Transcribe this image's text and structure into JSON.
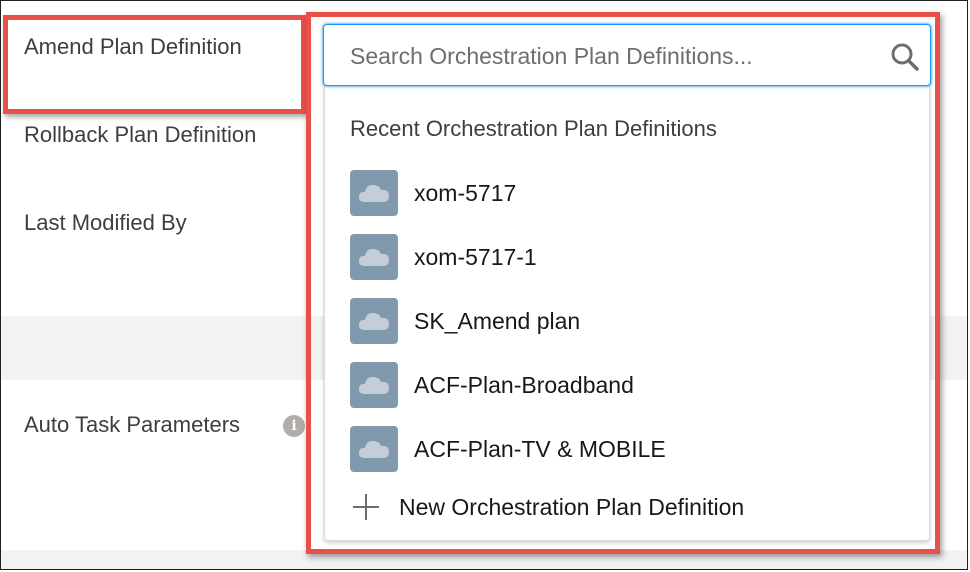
{
  "fields": {
    "amend_plan_definition": "Amend Plan Definition",
    "rollback_plan_definition": "Rollback Plan Definition",
    "last_modified_by": "Last Modified By",
    "auto_task_parameters": "Auto Task Parameters",
    "info_icon_glyph": "i"
  },
  "lookup": {
    "search_placeholder": "Search Orchestration Plan Definitions...",
    "search_value": "",
    "section_header": "Recent Orchestration Plan Definitions",
    "items": [
      {
        "label": "xom-5717",
        "icon": "orchestration-plan-icon"
      },
      {
        "label": "xom-5717-1",
        "icon": "orchestration-plan-icon"
      },
      {
        "label": "SK_Amend plan",
        "icon": "orchestration-plan-icon"
      },
      {
        "label": "ACF-Plan-Broadband",
        "icon": "orchestration-plan-icon"
      },
      {
        "label": "ACF-Plan-TV & MOBILE",
        "icon": "orchestration-plan-icon"
      }
    ],
    "new_action_label": "New Orchestration Plan Definition"
  },
  "colors": {
    "highlight": "#e8514a",
    "item_icon_bg": "#8199af",
    "focus_border": "#1b96ff"
  }
}
